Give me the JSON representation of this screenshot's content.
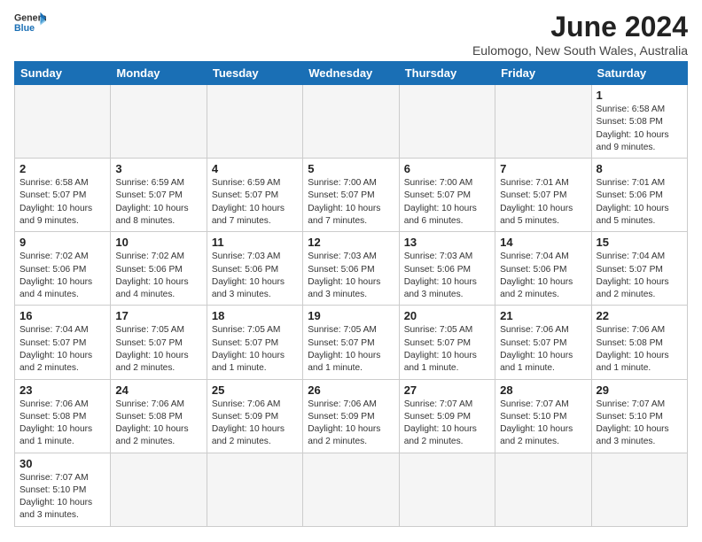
{
  "header": {
    "logo_general": "General",
    "logo_blue": "Blue",
    "month_title": "June 2024",
    "subtitle": "Eulomogo, New South Wales, Australia"
  },
  "weekdays": [
    "Sunday",
    "Monday",
    "Tuesday",
    "Wednesday",
    "Thursday",
    "Friday",
    "Saturday"
  ],
  "weeks": [
    [
      {
        "day": "",
        "info": ""
      },
      {
        "day": "",
        "info": ""
      },
      {
        "day": "",
        "info": ""
      },
      {
        "day": "",
        "info": ""
      },
      {
        "day": "",
        "info": ""
      },
      {
        "day": "",
        "info": ""
      },
      {
        "day": "1",
        "info": "Sunrise: 6:58 AM\nSunset: 5:08 PM\nDaylight: 10 hours\nand 9 minutes."
      }
    ],
    [
      {
        "day": "2",
        "info": "Sunrise: 6:58 AM\nSunset: 5:07 PM\nDaylight: 10 hours\nand 9 minutes."
      },
      {
        "day": "3",
        "info": "Sunrise: 6:59 AM\nSunset: 5:07 PM\nDaylight: 10 hours\nand 8 minutes."
      },
      {
        "day": "4",
        "info": "Sunrise: 6:59 AM\nSunset: 5:07 PM\nDaylight: 10 hours\nand 7 minutes."
      },
      {
        "day": "5",
        "info": "Sunrise: 7:00 AM\nSunset: 5:07 PM\nDaylight: 10 hours\nand 7 minutes."
      },
      {
        "day": "6",
        "info": "Sunrise: 7:00 AM\nSunset: 5:07 PM\nDaylight: 10 hours\nand 6 minutes."
      },
      {
        "day": "7",
        "info": "Sunrise: 7:01 AM\nSunset: 5:07 PM\nDaylight: 10 hours\nand 5 minutes."
      },
      {
        "day": "8",
        "info": "Sunrise: 7:01 AM\nSunset: 5:06 PM\nDaylight: 10 hours\nand 5 minutes."
      }
    ],
    [
      {
        "day": "9",
        "info": "Sunrise: 7:02 AM\nSunset: 5:06 PM\nDaylight: 10 hours\nand 4 minutes."
      },
      {
        "day": "10",
        "info": "Sunrise: 7:02 AM\nSunset: 5:06 PM\nDaylight: 10 hours\nand 4 minutes."
      },
      {
        "day": "11",
        "info": "Sunrise: 7:03 AM\nSunset: 5:06 PM\nDaylight: 10 hours\nand 3 minutes."
      },
      {
        "day": "12",
        "info": "Sunrise: 7:03 AM\nSunset: 5:06 PM\nDaylight: 10 hours\nand 3 minutes."
      },
      {
        "day": "13",
        "info": "Sunrise: 7:03 AM\nSunset: 5:06 PM\nDaylight: 10 hours\nand 3 minutes."
      },
      {
        "day": "14",
        "info": "Sunrise: 7:04 AM\nSunset: 5:06 PM\nDaylight: 10 hours\nand 2 minutes."
      },
      {
        "day": "15",
        "info": "Sunrise: 7:04 AM\nSunset: 5:07 PM\nDaylight: 10 hours\nand 2 minutes."
      }
    ],
    [
      {
        "day": "16",
        "info": "Sunrise: 7:04 AM\nSunset: 5:07 PM\nDaylight: 10 hours\nand 2 minutes."
      },
      {
        "day": "17",
        "info": "Sunrise: 7:05 AM\nSunset: 5:07 PM\nDaylight: 10 hours\nand 2 minutes."
      },
      {
        "day": "18",
        "info": "Sunrise: 7:05 AM\nSunset: 5:07 PM\nDaylight: 10 hours\nand 1 minute."
      },
      {
        "day": "19",
        "info": "Sunrise: 7:05 AM\nSunset: 5:07 PM\nDaylight: 10 hours\nand 1 minute."
      },
      {
        "day": "20",
        "info": "Sunrise: 7:05 AM\nSunset: 5:07 PM\nDaylight: 10 hours\nand 1 minute."
      },
      {
        "day": "21",
        "info": "Sunrise: 7:06 AM\nSunset: 5:07 PM\nDaylight: 10 hours\nand 1 minute."
      },
      {
        "day": "22",
        "info": "Sunrise: 7:06 AM\nSunset: 5:08 PM\nDaylight: 10 hours\nand 1 minute."
      }
    ],
    [
      {
        "day": "23",
        "info": "Sunrise: 7:06 AM\nSunset: 5:08 PM\nDaylight: 10 hours\nand 1 minute."
      },
      {
        "day": "24",
        "info": "Sunrise: 7:06 AM\nSunset: 5:08 PM\nDaylight: 10 hours\nand 2 minutes."
      },
      {
        "day": "25",
        "info": "Sunrise: 7:06 AM\nSunset: 5:09 PM\nDaylight: 10 hours\nand 2 minutes."
      },
      {
        "day": "26",
        "info": "Sunrise: 7:06 AM\nSunset: 5:09 PM\nDaylight: 10 hours\nand 2 minutes."
      },
      {
        "day": "27",
        "info": "Sunrise: 7:07 AM\nSunset: 5:09 PM\nDaylight: 10 hours\nand 2 minutes."
      },
      {
        "day": "28",
        "info": "Sunrise: 7:07 AM\nSunset: 5:10 PM\nDaylight: 10 hours\nand 2 minutes."
      },
      {
        "day": "29",
        "info": "Sunrise: 7:07 AM\nSunset: 5:10 PM\nDaylight: 10 hours\nand 3 minutes."
      }
    ],
    [
      {
        "day": "30",
        "info": "Sunrise: 7:07 AM\nSunset: 5:10 PM\nDaylight: 10 hours\nand 3 minutes."
      },
      {
        "day": "",
        "info": ""
      },
      {
        "day": "",
        "info": ""
      },
      {
        "day": "",
        "info": ""
      },
      {
        "day": "",
        "info": ""
      },
      {
        "day": "",
        "info": ""
      },
      {
        "day": "",
        "info": ""
      }
    ]
  ]
}
